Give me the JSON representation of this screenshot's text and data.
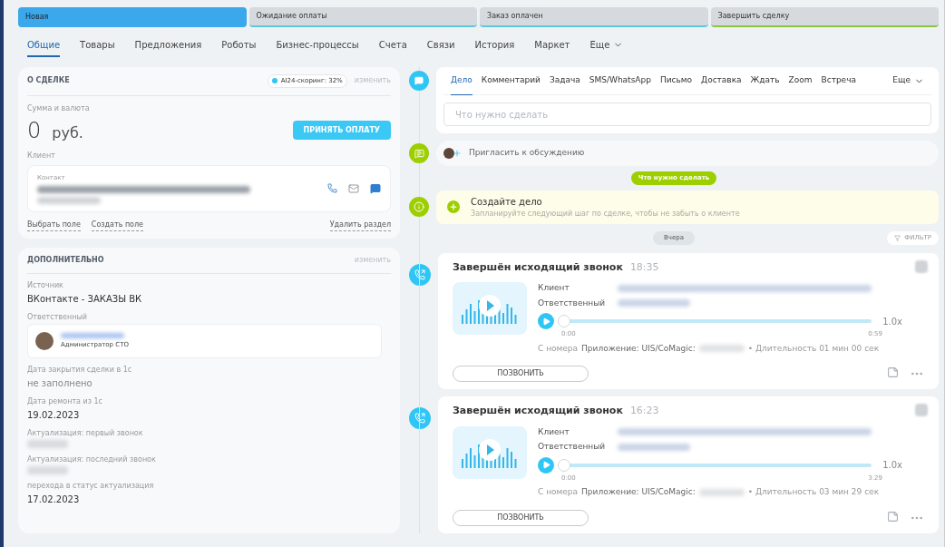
{
  "stages": [
    {
      "label": "Новая",
      "selected": true,
      "color": "#3aa8ea"
    },
    {
      "label": "Ожидание оплаты",
      "selected": false,
      "color": "#5bc8e0"
    },
    {
      "label": "Заказ оплачен",
      "selected": false,
      "color": "#5bc8e0"
    },
    {
      "label": "Завершить сделку",
      "selected": false,
      "color": "#8cc63f"
    }
  ],
  "tabs": [
    {
      "label": "Общие",
      "selected": true
    },
    {
      "label": "Товары",
      "selected": false
    },
    {
      "label": "Предложения",
      "selected": false
    },
    {
      "label": "Роботы",
      "selected": false
    },
    {
      "label": "Бизнес-процессы",
      "selected": false
    },
    {
      "label": "Счета",
      "selected": false
    },
    {
      "label": "Связи",
      "selected": false
    },
    {
      "label": "История",
      "selected": false
    },
    {
      "label": "Маркет",
      "selected": false
    },
    {
      "label": "Еще",
      "selected": false,
      "kind": "more"
    }
  ],
  "deal": {
    "title": "О СДЕЛКЕ",
    "scoring": "AI24-скоринг: 32%",
    "edit": "изменить",
    "amount_label": "Сумма и валюта",
    "amount": "0",
    "currency": "руб.",
    "pay_button": "ПРИНЯТЬ ОПЛАТУ",
    "client_label": "Клиент",
    "contact_label": "Контакт",
    "links": [
      "Выбрать поле",
      "Создать поле"
    ],
    "delete": "Удалить раздел"
  },
  "extra": {
    "title": "ДОПОЛНИТЕЛЬНО",
    "edit": "изменить",
    "fields": [
      {
        "kind": "text",
        "label": "Источник",
        "value": "ВКонтакте - ЗАКАЗЫ ВК"
      },
      {
        "kind": "person",
        "label": "Ответственный",
        "role": "Администратор СТО"
      },
      {
        "kind": "empty",
        "label": "Дата закрытия сделки в 1с",
        "value": "не заполнено"
      },
      {
        "kind": "text",
        "label": "Дата ремонта из 1с",
        "value": "19.02.2023"
      },
      {
        "kind": "hidden",
        "label": "Актуализация: первый звонок"
      },
      {
        "kind": "hidden",
        "label": "Актуализация: последний звонок"
      },
      {
        "kind": "text",
        "label": "перехода в статус актуализация",
        "value": "17.02.2023"
      }
    ]
  },
  "activity_tabs": [
    {
      "label": "Дело",
      "selected": true
    },
    {
      "label": "Комментарий",
      "selected": false
    },
    {
      "label": "Задача",
      "selected": false
    },
    {
      "label": "SMS/WhatsApp",
      "selected": false
    },
    {
      "label": "Письмо",
      "selected": false
    },
    {
      "label": "Доставка",
      "selected": false
    },
    {
      "label": "Ждать",
      "selected": false
    },
    {
      "label": "Zoom",
      "selected": false
    },
    {
      "label": "Встреча",
      "selected": false
    }
  ],
  "activity_more": "Еще",
  "todo_placeholder": "Что нужно сделать",
  "invite": "Пригласить к обсуждению",
  "todo_badge": "Что нужно сделать",
  "create": {
    "title": "Создайте дело",
    "hint": "Запланируйте следующий шаг по сделке, чтобы не забыть о клиенте"
  },
  "day": "Вчера",
  "filter": "ФИЛЬТР",
  "calls": [
    {
      "title": "Завершён исходящий звонок",
      "time": "18:35",
      "client_label": "Клиент",
      "resp_label": "Ответственный",
      "level": 0,
      "start": "0:00",
      "end": "0:59",
      "speed": "1.0x",
      "from": "С номера",
      "app": "Приложение: UIS/CoMagic:",
      "duration": "• Длительность 01 мин 00 сек",
      "button": "ПОЗВОНИТЬ"
    },
    {
      "title": "Завершён исходящий звонок",
      "time": "16:23",
      "client_label": "Клиент",
      "resp_label": "Ответственный",
      "level": 0,
      "start": "0:00",
      "end": "3:29",
      "speed": "1.0x",
      "from": "С номера",
      "app": "Приложение: UIS/CoMagic:",
      "duration": "• Длительность 03 мин 29 сек",
      "button": "ПОЗВОНИТЬ"
    }
  ]
}
